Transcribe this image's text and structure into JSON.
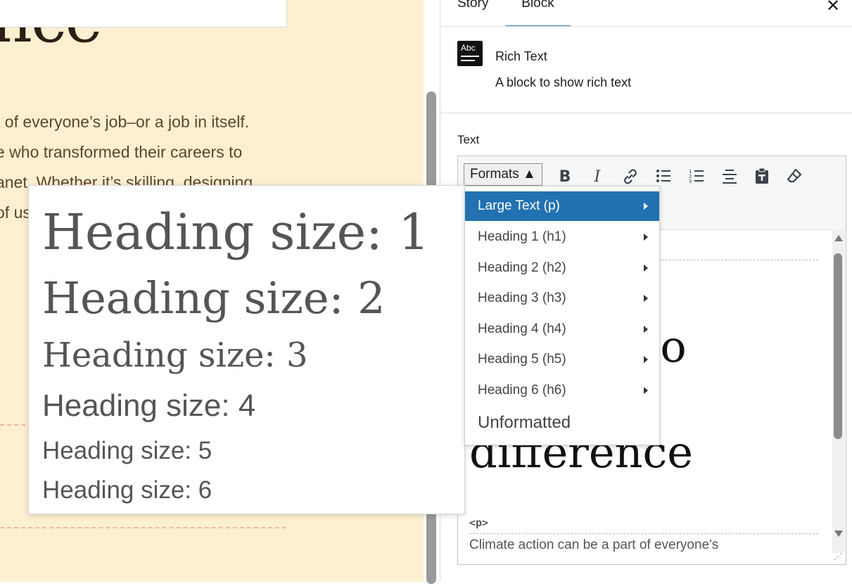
{
  "canvas": {
    "heading_fragment": "nce",
    "body_lines": [
      "t of everyone’s job–or a job in itself.",
      "e who transformed their careers to",
      "anet. Whether it’s skilling, designing",
      "of us"
    ],
    "background_color": "#fdf0d0"
  },
  "sidebar": {
    "tabs": [
      "Story",
      "Block"
    ],
    "active_tab": "Block",
    "close_icon": "close-icon",
    "block_card": {
      "icon_text": "Abc",
      "title": "Rich Text",
      "description": "A block to show rich text"
    },
    "field_label": "Text",
    "toolbar": {
      "formats_label": "Formats ▲",
      "buttons": [
        "bold-icon",
        "italic-icon",
        "link-icon",
        "bullet-list-icon",
        "numbered-list-icon",
        "align-center-icon",
        "paste-icon",
        "eraser-icon"
      ]
    },
    "editor_content": {
      "big_line_1": "e to",
      "big_line_2": "difference",
      "tag": "<p>",
      "paragraph_start": "Climate action can be a part of everyone's"
    }
  },
  "formats_menu": {
    "items": [
      {
        "label": "Large Text (p)",
        "has_submenu": true,
        "active": true
      },
      {
        "label": "Heading 1 (h1)",
        "has_submenu": true
      },
      {
        "label": "Heading 2 (h2)",
        "has_submenu": true
      },
      {
        "label": "Heading 3 (h3)",
        "has_submenu": true
      },
      {
        "label": "Heading 4 (h4)",
        "has_submenu": true
      },
      {
        "label": "Heading 5 (h5)",
        "has_submenu": true
      },
      {
        "label": "Heading 6 (h6)",
        "has_submenu": true
      },
      {
        "label": "Unformatted",
        "has_submenu": false
      }
    ],
    "active_color": "#2271b1"
  },
  "heading_preview": {
    "items": [
      "Heading size: 1",
      "Heading size: 2",
      "Heading size: 3",
      "Heading size: 4",
      "Heading size: 5",
      "Heading size: 6"
    ]
  }
}
